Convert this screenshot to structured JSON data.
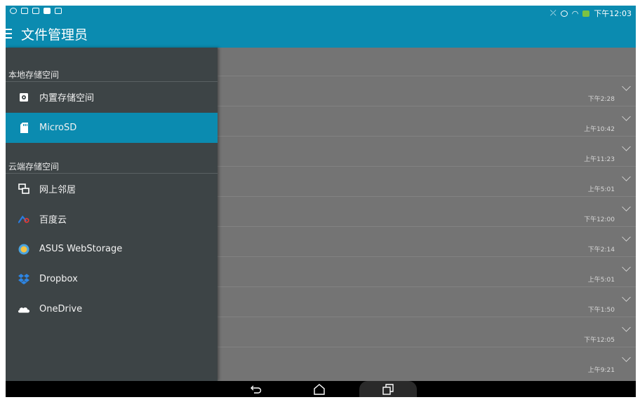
{
  "status": {
    "time": "下午12:03",
    "left_icons": [
      "timer-icon",
      "screen-icon",
      "mail-icon",
      "file-icon",
      "tablet-icon"
    ],
    "right_icons": [
      "mute-icon",
      "alarm-icon",
      "wifi-icon",
      "battery-charging-icon"
    ]
  },
  "appbar": {
    "title": "文件管理员"
  },
  "drawer": {
    "local_section": "本地存储空间",
    "cloud_section": "云端存储空间",
    "local_items": [
      {
        "label": "内置存储空间",
        "icon": "internal-storage-icon"
      },
      {
        "label": "MicroSD",
        "icon": "sd-card-icon",
        "selected": true
      }
    ],
    "cloud_items": [
      {
        "label": "网上邻居",
        "icon": "network-icon"
      },
      {
        "label": "百度云",
        "icon": "baidu-cloud-icon"
      },
      {
        "label": "ASUS WebStorage",
        "icon": "asus-webstorage-icon"
      },
      {
        "label": "Dropbox",
        "icon": "dropbox-icon"
      },
      {
        "label": "OneDrive",
        "icon": "onedrive-icon"
      }
    ]
  },
  "list": {
    "times": [
      "下午2:28",
      "上午10:42",
      "上午11:23",
      "上午5:01",
      "下午12:00",
      "下午2:14",
      "上午5:01",
      "下午1:50",
      "下午12:05",
      "上午9:21"
    ]
  },
  "colors": {
    "accent": "#0b8bb0",
    "drawer_bg": "#3d4446"
  }
}
